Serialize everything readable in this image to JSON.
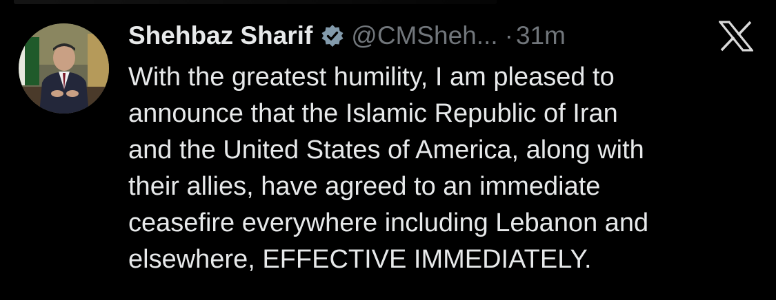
{
  "tweet": {
    "author_name": "Shehbaz Sharif",
    "handle": "@CMSheh...",
    "separator": "·",
    "time": "31m",
    "body_lines": [
      "With the greatest humility, I am pleased to",
      "announce that the Islamic Republic of Iran",
      "and the United States of America, along with",
      "their allies, have agreed to an immediate",
      "ceasefire everywhere including Lebanon and",
      "elsewhere, EFFECTIVE IMMEDIATELY."
    ]
  },
  "icons": {
    "verified": "verified-badge-icon",
    "brand": "x-logo-icon"
  },
  "colors": {
    "background": "#000000",
    "text_primary": "#e7e9ea",
    "text_secondary": "#71767b"
  }
}
